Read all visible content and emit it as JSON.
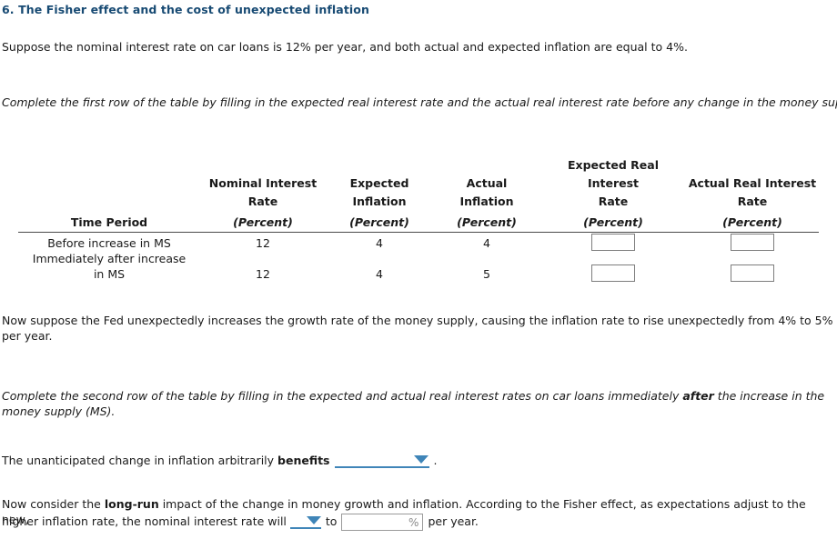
{
  "question": {
    "number_title": "6. The Fisher effect and the cost of unexpected inflation",
    "title_color": "#174a73"
  },
  "intro": {
    "text": "Suppose the nominal interest rate on car loans is 12% per year, and both actual and expected inflation are equal to 4%."
  },
  "instruction_one": {
    "text": "Complete the first row of the table by filling in the expected real interest rate and the actual real interest rate before any change in the money supply."
  },
  "table": {
    "columns": [
      {
        "label": "Time Period",
        "line2": "",
        "unit": ""
      },
      {
        "label": "Nominal Interest",
        "line2": "Rate",
        "unit": "(Percent)"
      },
      {
        "label": "Expected",
        "line2": "Inflation",
        "unit": "(Percent)"
      },
      {
        "label": "Actual",
        "line2": "Inflation",
        "unit": "(Percent)"
      },
      {
        "label": "Expected Real Interest",
        "line2": "Rate",
        "unit": "(Percent)"
      },
      {
        "label": "Actual Real Interest",
        "line2": "Rate",
        "unit": "(Percent)"
      }
    ],
    "rows": [
      {
        "period": "Before increase in MS",
        "period_line2": "",
        "nominal_rate": "12",
        "expected_inflation": "4",
        "actual_inflation": "4",
        "expected_real_rate": "",
        "actual_real_rate": ""
      },
      {
        "period": "Immediately after increase",
        "period_line2": "in MS",
        "nominal_rate": "12",
        "expected_inflation": "4",
        "actual_inflation": "5",
        "expected_real_rate": "",
        "actual_real_rate": ""
      }
    ]
  },
  "fed_paragraph": {
    "text": "Now suppose the Fed unexpectedly increases the growth rate of the money supply, causing the inflation rate to rise unexpectedly from 4% to 5% per year."
  },
  "instruction_two": {
    "part1": "Complete the second row of the table by filling in the expected and actual real interest rates on car loans immediately ",
    "emphasis": "after",
    "part2": " the increase in the money supply (MS)."
  },
  "benefits_line": {
    "part1": "The unanticipated change in inflation arbitrarily ",
    "emphasis": "benefits",
    "dropdown_value": "",
    "period": "."
  },
  "longrun_line": {
    "part1": "Now consider the ",
    "emphasis": "long-run",
    "part2": " impact of the change in money growth and inflation. According to the Fisher effect, as expectations adjust to the new,",
    "line2_part1": "higher inflation rate, the nominal interest rate will ",
    "direction_dropdown_value": "",
    "line2_part2": "to",
    "percent_value": "",
    "percent_suffix": "%",
    "line2_part3": "per year."
  },
  "colors": {
    "accent_blue": "#3f85b8",
    "title_navy": "#174a73",
    "input_border": "#7d7d7d",
    "rule": "#4a4a4a"
  }
}
